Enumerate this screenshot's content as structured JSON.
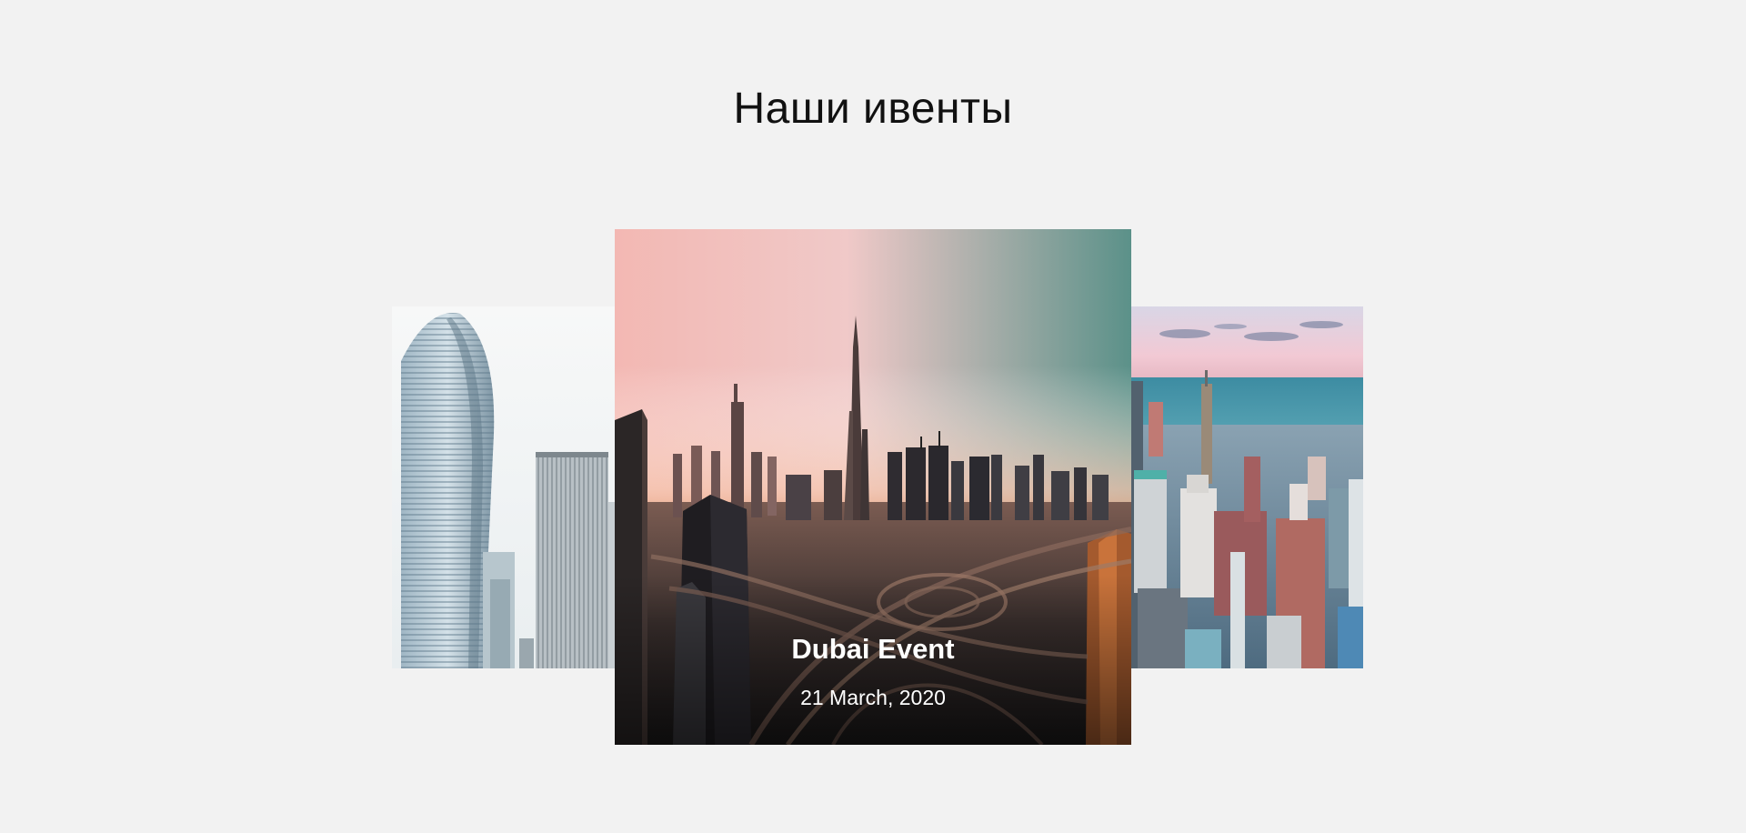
{
  "section": {
    "title": "Наши ивенты"
  },
  "carousel": {
    "active_event": {
      "title": "Dubai Event",
      "date": "21 March, 2020"
    }
  },
  "colors": {
    "background": "#f2f2f2",
    "caption_text": "#ffffff",
    "title_text": "#111111"
  }
}
